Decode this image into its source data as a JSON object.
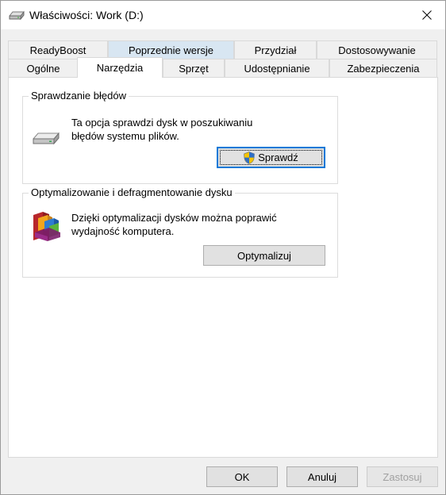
{
  "window": {
    "title": "Właściwości: Work (D:)"
  },
  "tabs": {
    "row1": [
      {
        "label": "ReadyBoost"
      },
      {
        "label": "Poprzednie wersje"
      },
      {
        "label": "Przydział"
      },
      {
        "label": "Dostosowywanie"
      }
    ],
    "row2": [
      {
        "label": "Ogólne"
      },
      {
        "label": "Narzędzia"
      },
      {
        "label": "Sprzęt"
      },
      {
        "label": "Udostępnianie"
      },
      {
        "label": "Zabezpieczenia"
      }
    ],
    "active": "Narzędzia",
    "hovered": "Poprzednie wersje"
  },
  "error_check": {
    "title": "Sprawdzanie błędów",
    "description_line1": "Ta opcja sprawdzi dysk w poszukiwaniu",
    "description_line2": "błędów systemu plików.",
    "button_label": "Sprawdź",
    "icon": "drive-icon",
    "button_icon": "uac-shield-icon"
  },
  "optimize": {
    "title": "Optymalizowanie i defragmentowanie dysku",
    "description_line1": "Dzięki optymalizacji dysków można poprawić",
    "description_line2": "wydajność komputera.",
    "button_label": "Optymalizuj",
    "icon": "defrag-icon"
  },
  "footer": {
    "ok_label": "OK",
    "cancel_label": "Anuluj",
    "apply_label": "Zastosuj"
  },
  "colors": {
    "accent": "#0078d7",
    "tab_hover": "#d8e6f2"
  }
}
